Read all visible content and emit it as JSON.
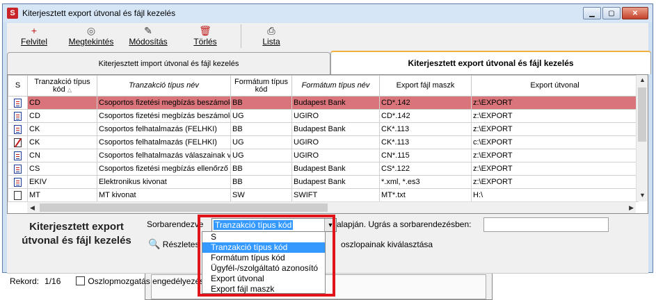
{
  "window": {
    "title": "Kiterjesztett export útvonal és fájl kezelés",
    "controls": [
      "minimize",
      "maximize",
      "close"
    ]
  },
  "toolbar": {
    "buttons": [
      {
        "label": "Felvitel",
        "icon": "plus-icon",
        "glyph": "+",
        "color": "#c01818"
      },
      {
        "label": "Megtekintés",
        "icon": "eye-icon",
        "glyph": "👁",
        "color": "#555555"
      },
      {
        "label": "Módosítás",
        "icon": "edit-icon",
        "glyph": "✎",
        "color": "#333333"
      },
      {
        "label": "Törlés",
        "icon": "trash-icon",
        "glyph": "🗑",
        "color": "#c01818"
      },
      {
        "label": "Lista",
        "icon": "printer-icon",
        "glyph": "🖶",
        "color": "#222222"
      }
    ]
  },
  "tabs": [
    {
      "label": "Kiterjesztett import útvonal és fájl kezelés",
      "active": false
    },
    {
      "label": "Kiterjesztett export útvonal és fájl kezelés",
      "active": true
    }
  ],
  "grid": {
    "columns": [
      {
        "label": "S",
        "italic": false
      },
      {
        "label": "Tranzakció típus kód",
        "italic": false,
        "sorted": "asc"
      },
      {
        "label": "Tranzakció típus név",
        "italic": true
      },
      {
        "label": "Formátum típus kód",
        "italic": false
      },
      {
        "label": "Formátum típus név",
        "italic": true
      },
      {
        "label": "Export fájl maszk",
        "italic": false
      },
      {
        "label": "Export útvonal",
        "italic": false
      }
    ],
    "rows": [
      {
        "icon": "doc",
        "cells": [
          "CD",
          "Csoportos fizetési megbízás beszámoló",
          "BB",
          "Budapest Bank",
          "CD*.142",
          "z:\\EXPORT"
        ],
        "selected": true
      },
      {
        "icon": "doc",
        "cells": [
          "CD",
          "Csoportos fizetési megbízás beszámoló",
          "UG",
          "UGIRO",
          "CD*.142",
          "z:\\EXPORT"
        ],
        "selected": false
      },
      {
        "icon": "doc",
        "cells": [
          "CK",
          "Csoportos felhatalmazás (FELHKI)",
          "BB",
          "Budapest Bank",
          "CK*.113",
          "z:\\EXPORT"
        ],
        "selected": false
      },
      {
        "icon": "edit",
        "cells": [
          "CK",
          "Csoportos felhatalmazás (FELHKI)",
          "UG",
          "UGIRO",
          "CK*.113",
          "c:\\EXPORT"
        ],
        "selected": false
      },
      {
        "icon": "doc",
        "cells": [
          "CN",
          "Csoportos felhatalmazás válaszainak v",
          "UG",
          "UGIRO",
          "CN*.115",
          "z:\\EXPORT"
        ],
        "selected": false
      },
      {
        "icon": "doc",
        "cells": [
          "CS",
          "Csoportos fizetési megbízás ellenőrző j",
          "BB",
          "Budapest Bank",
          "CS*.122",
          "z:\\EXPORT"
        ],
        "selected": false
      },
      {
        "icon": "doc",
        "cells": [
          "EKIV",
          "Elektronikus kivonat",
          "BB",
          "Budapest Bank",
          "*.xml, *.es3",
          "z:\\EXPORT"
        ],
        "selected": false
      },
      {
        "icon": "blank",
        "cells": [
          "MT",
          "MT kivonat",
          "SW",
          "SWIFT",
          "MT*.txt",
          "H:\\"
        ],
        "selected": false
      }
    ]
  },
  "bottom": {
    "title_line1": "Kiterjesztett export",
    "title_line2": "útvonal és fájl kezelés",
    "sort_label": "Sorbarendezve",
    "sort_value": "Tranzakció típus kód",
    "sort_suffix": "alapján. Ugrás a sorbarendezésben:",
    "details_label": "Részletes",
    "columns_label": "oszlopainak kiválasztása"
  },
  "dropdown": {
    "options": [
      "S",
      "Tranzakció típus kód",
      "Formátum típus kód",
      "Ügyfél-/szolgáltató azonosító",
      "Export útvonal",
      "Export fájl maszk"
    ],
    "highlighted": 1
  },
  "status": {
    "record_label": "Rekord:",
    "record_value": "1/16",
    "checkbox_label": "Oszlopmozgatás engedélyezése"
  },
  "colors": {
    "selected_row": "#d9747a",
    "highlight": "#3399ff",
    "annotation_box": "#e0151b",
    "active_tab_accent": "#f0b040"
  }
}
